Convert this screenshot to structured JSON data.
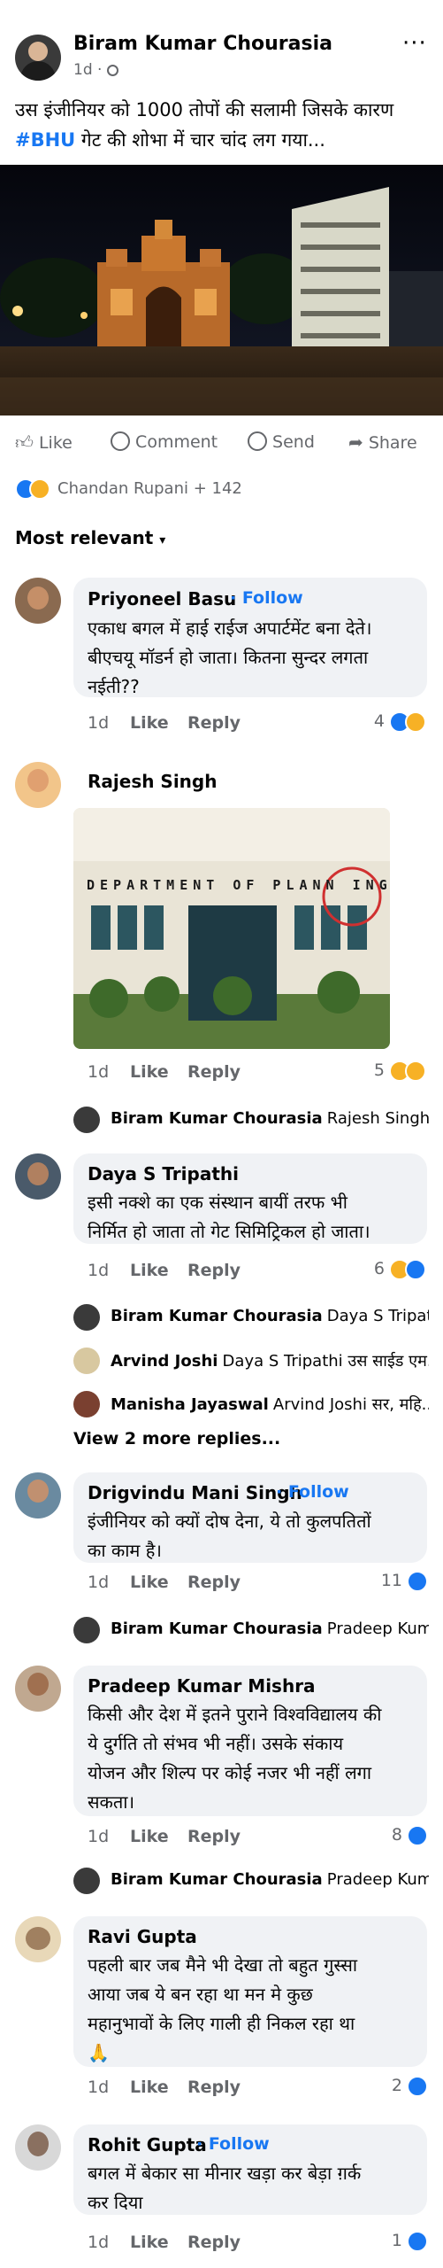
{
  "post": {
    "author": "Biram Kumar Chourasia",
    "time": "1d · ",
    "more": "···",
    "text_line1": "उस इंजीनियर को 1000 तोपों की सलामी जिसके कारण",
    "hashtag": "#BHU",
    "text_line2_rest": " गेट की शोभा में चार चांद लग गया..."
  },
  "actions": {
    "like": "Like",
    "comment": "Comment",
    "send": "Send",
    "share": "Share"
  },
  "reactions_summary": "Chandan Rupani + 142",
  "sort_label": "Most relevant",
  "comments": [
    {
      "name": "Priyoneel Basu",
      "follow": "Follow",
      "lines": [
        "एकाध बगल में हाई राईज अपार्टमेंट बना देते।",
        "बीएचयू मॉडर्न हो जाता। कितना सुन्दर लगता",
        "नईती??"
      ],
      "time": "1d",
      "like": "Like",
      "reply": "Reply",
      "count": "4"
    },
    {
      "name": "Rajesh Singh",
      "image_text": "DEPARTMENT OF PLANN ING",
      "time": "1d",
      "like": "Like",
      "reply": "Reply",
      "count": "5",
      "replies": [
        {
          "name": "Biram Kumar Chourasia",
          "text": "Rajesh Singh..."
        }
      ]
    },
    {
      "name": "Daya S Tripathi",
      "lines": [
        "इसी नक्शे का एक संस्थान बायीं तरफ भी",
        "निर्मित हो जाता तो गेट सिमिट्रिकल हो जाता।"
      ],
      "time": "1d",
      "like": "Like",
      "reply": "Reply",
      "count": "6",
      "replies": [
        {
          "name": "Biram Kumar Chourasia",
          "text": "Daya S Tripath..."
        },
        {
          "name": "Arvind Joshi",
          "text": "Daya S Tripathi उस साईड एम..."
        },
        {
          "name": "Manisha Jayaswal",
          "text": "Arvind Joshi सर, महि..."
        }
      ],
      "view_more": "View 2 more replies..."
    },
    {
      "name": "Drigvindu Mani Singh",
      "follow": "Follow",
      "lines": [
        "इंजीनियर को क्यों दोष देना, ये तो कुलपतितों",
        "का काम है।"
      ],
      "time": "1d",
      "like": "Like",
      "reply": "Reply",
      "count": "11",
      "replies": [
        {
          "name": "Biram Kumar Chourasia",
          "text": "Pradeep Kum..."
        }
      ]
    },
    {
      "name": "Pradeep Kumar Mishra",
      "lines": [
        "किसी और देश में इतने पुराने विश्वविद्यालय की",
        "ये दुर्गति तो संभव भी नहीं। उसके संकाय",
        "योजन और शिल्प पर कोई नजर भी नहीं लगा",
        "सकता।"
      ],
      "time": "1d",
      "like": "Like",
      "reply": "Reply",
      "count": "8",
      "replies": [
        {
          "name": "Biram Kumar Chourasia",
          "text": "Pradeep Kum..."
        }
      ]
    },
    {
      "name": "Ravi Gupta",
      "lines": [
        "पहली बार जब मैने भी देखा तो बहुत गुस्सा",
        "आया जब ये बन रहा था मन मे कुछ",
        "महानुभावों के लिए गाली ही निकल रहा था",
        "🙏"
      ],
      "time": "1d",
      "like": "Like",
      "reply": "Reply",
      "count": "2"
    },
    {
      "name": "Rohit Gupta",
      "follow": "Follow",
      "lines": [
        "बगल में बेकार सा मीनार खड़ा कर बेड़ा ग़र्क",
        "कर दिया"
      ],
      "time": "1d",
      "like": "Like",
      "reply": "Reply",
      "count": "1"
    }
  ]
}
